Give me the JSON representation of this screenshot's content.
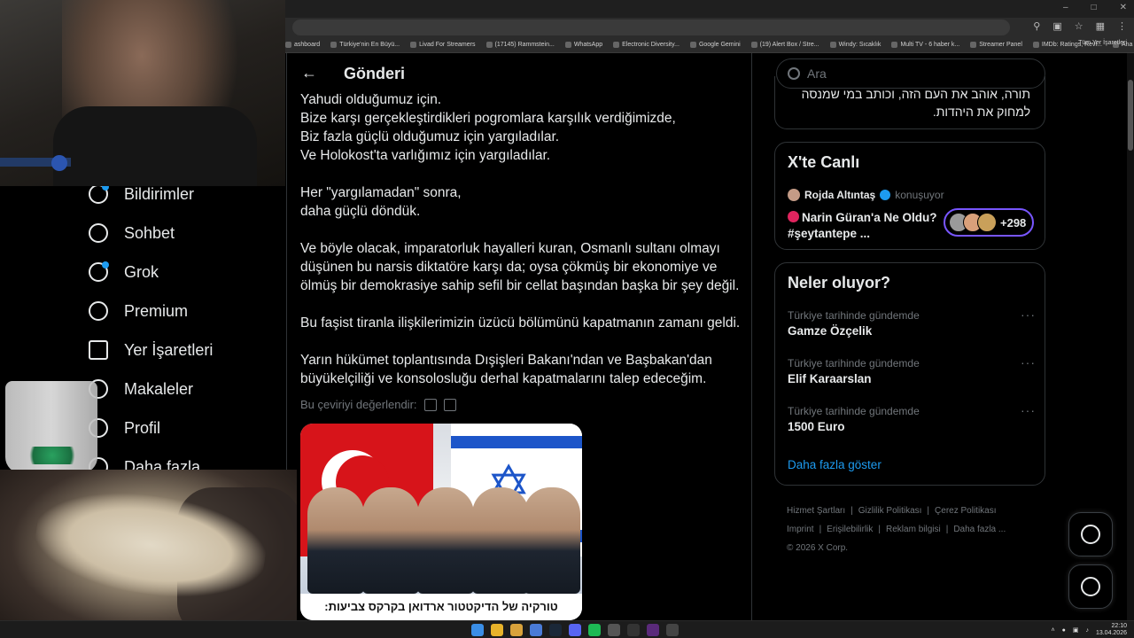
{
  "browser": {
    "bookmarks": [
      "ashboard",
      "Türkiye'nin En Büyü...",
      "Livad For Streamers",
      "(17145) Rammstein...",
      "WhatsApp",
      "Electronic Diversity...",
      "Google Gemini",
      "(19) Alert Box / Stre...",
      "Windy: Sıcaklık",
      "Multi TV - 6 haber k...",
      "Streamer Panel",
      "IMDb: Ratings, Revi...",
      "Ana Sayfa • HBO Max"
    ],
    "all_bookmarks": "Tüm Yer İşaretleri"
  },
  "nav": {
    "items": [
      {
        "label": "Bildirimler",
        "icon": "bell-icon"
      },
      {
        "label": "Sohbet",
        "icon": "chat-icon"
      },
      {
        "label": "Grok",
        "icon": "grok-icon"
      },
      {
        "label": "Premium",
        "icon": "premium-icon"
      },
      {
        "label": "Yer İşaretleri",
        "icon": "bookmark-icon"
      },
      {
        "label": "Makaleler",
        "icon": "article-icon"
      },
      {
        "label": "Profil",
        "icon": "profile-icon"
      },
      {
        "label": "Daha fazla",
        "icon": "more-icon"
      }
    ]
  },
  "main": {
    "title": "Gönderi",
    "post_lines": [
      [
        "Yahudi olduğumuz için.",
        "Bize karşı gerçekleştirdikleri pogromlara karşılık verdiğimizde,",
        "Biz fazla güçlü olduğumuz için yargıladılar.",
        "Ve Holokost'ta varlığımız için yargıladılar."
      ],
      [
        "Her \"yargılamadan\" sonra,",
        "daha güçlü döndük."
      ],
      [
        "Ve böyle olacak, imparatorluk hayalleri kuran, Osmanlı sultanı olmayı düşünen bu narsis diktatöre karşı da; oysa çökmüş bir ekonomiye ve ölmüş bir demokrasiye sahip sefil bir cellat başından başka bir şey değil."
      ],
      [
        "Bu faşist tiranla ilişkilerimizin üzücü bölümünü kapatmanın zamanı geldi."
      ],
      [
        "Yarın hükümet toplantısında Dışişleri Bakanı'ndan ve Başbakan'dan büyükelçiliği ve konsolosluğu derhal kapatmalarını talep edeceğim."
      ]
    ],
    "rate_translation": "Bu çeviriyi değerlendir:",
    "media_caption": "טורקיה של הדיקטטור ארדואן בקרקס צביעות:"
  },
  "right": {
    "search_placeholder": "Ara",
    "hebrew_text": "תורה, אוהב את העם הזה, וכותב במי שמנסה למחוק את היהדות.",
    "live": {
      "title": "X'te Canlı",
      "user": "Rojda Altıntaş",
      "status": "konuşuyor",
      "space_title": "Narin Güran'a Ne Oldu? #şeytantepe ...",
      "listeners": "+298"
    },
    "trends": {
      "title": "Neler oluyor?",
      "items": [
        {
          "context": "Türkiye tarihinde gündemde",
          "name": "Gamze Özçelik"
        },
        {
          "context": "Türkiye tarihinde gündemde",
          "name": "Elif Karaarslan"
        },
        {
          "context": "Türkiye tarihinde gündemde",
          "name": "1500 Euro"
        }
      ],
      "show_more": "Daha fazla göster"
    },
    "footer": [
      "Hizmet Şartları",
      "Gizlilik Politikası",
      "Çerez Politikası",
      "Imprint",
      "Erişilebilirlik",
      "Reklam bilgisi",
      "Daha fazla ...",
      "© 2026 X Corp."
    ]
  },
  "taskbar": {
    "time": "22:10",
    "date": "13.04.2026"
  },
  "colors": {
    "accent": "#1d9bf0",
    "live_border": "#7856ff",
    "muted": "#71767b"
  }
}
